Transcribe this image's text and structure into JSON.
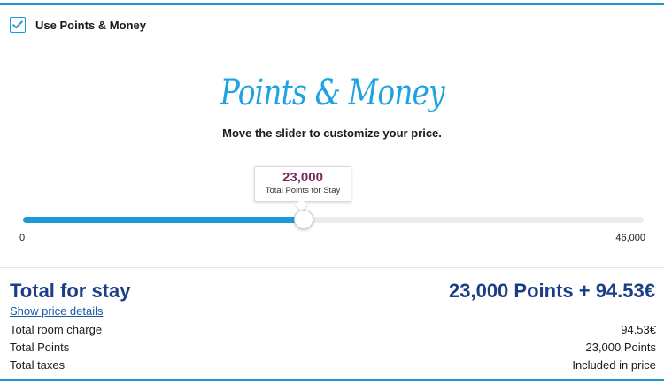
{
  "colors": {
    "accent": "#1c9ad6",
    "total_blue": "#1b3f86",
    "tooltip_value": "#7a2a5e"
  },
  "points_money_toggle": {
    "label": "Use Points & Money",
    "checked": true,
    "icon": "checkmark-icon"
  },
  "logo": {
    "text": "Points & Money"
  },
  "subtitle": "Move the slider to customize your price.",
  "slider": {
    "value_label": "23,000",
    "value_caption": "Total Points for Stay",
    "min_label": "0",
    "max_label": "46,000",
    "fill_fraction": 0.45
  },
  "summary": {
    "title": "Total for stay",
    "price": "23,000 Points + 94.53€",
    "details_link": "Show price details",
    "rows": [
      {
        "label": "Total room charge",
        "value": "94.53€"
      },
      {
        "label": "Total Points",
        "value": "23,000 Points"
      },
      {
        "label": "Total taxes",
        "value": "Included in price"
      }
    ]
  }
}
